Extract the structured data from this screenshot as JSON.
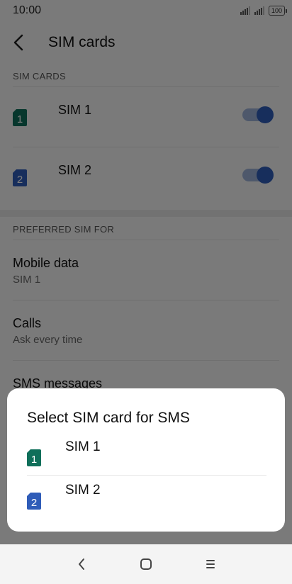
{
  "status": {
    "time": "10:00",
    "battery": "100"
  },
  "appbar": {
    "title": "SIM cards"
  },
  "sections": {
    "sim_cards": "SIM CARDS",
    "preferred": "PREFERRED SIM FOR"
  },
  "sims": [
    {
      "label": "SIM 1",
      "badge": "1",
      "color": "#0f6f5a",
      "enabled": true
    },
    {
      "label": "SIM 2",
      "badge": "2",
      "color": "#2f5cb8",
      "enabled": true
    }
  ],
  "preferences": [
    {
      "title": "Mobile data",
      "subtitle": "SIM 1"
    },
    {
      "title": "Calls",
      "subtitle": "Ask every time"
    },
    {
      "title": "SMS messages",
      "subtitle": ""
    }
  ],
  "dialog": {
    "title": "Select SIM card for SMS",
    "options": [
      {
        "label": "SIM 1",
        "badge": "1"
      },
      {
        "label": "SIM 2",
        "badge": "2"
      }
    ]
  },
  "icons": {
    "back": "back-arrow-icon",
    "nav_back": "nav-back-icon",
    "nav_home": "nav-home-icon",
    "nav_menu": "nav-menu-icon"
  }
}
